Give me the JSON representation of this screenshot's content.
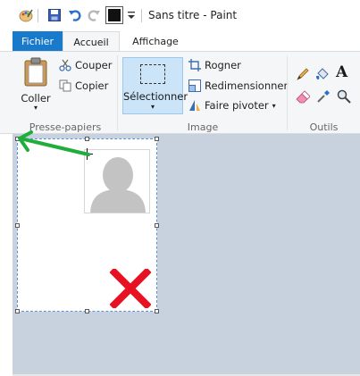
{
  "window": {
    "title": "Sans titre - Paint"
  },
  "quick_access": [
    "paint-app-icon",
    "save-icon",
    "undo-icon",
    "redo-icon",
    "color-swatch-icon",
    "customize-dropdown-icon"
  ],
  "tabs": [
    {
      "label": "Fichier",
      "active": false
    },
    {
      "label": "Accueil",
      "active": true
    },
    {
      "label": "Affichage",
      "active": false
    }
  ],
  "ribbon": {
    "clipboard": {
      "paste_label": "Coller",
      "cut_label": "Couper",
      "copy_label": "Copier",
      "group_label": "Presse-papiers"
    },
    "image": {
      "select_label": "Sélectionner",
      "crop_label": "Rogner",
      "resize_label": "Redimensionner",
      "rotate_label": "Faire pivoter",
      "group_label": "Image"
    },
    "tools": {
      "group_label": "Outils",
      "items": [
        "pencil-icon",
        "fill-icon",
        "text-icon",
        "eraser-icon",
        "color-picker-icon",
        "magnifier-icon"
      ],
      "text_tool_glyph": "A"
    }
  },
  "colors": {
    "accent": "#1979ca",
    "ribbon_bg": "#f5f6f7",
    "workspace_bg": "#c8d1de",
    "selection": "#cce4f7",
    "arrow": "#1fae3b",
    "x_mark": "#e81123"
  }
}
